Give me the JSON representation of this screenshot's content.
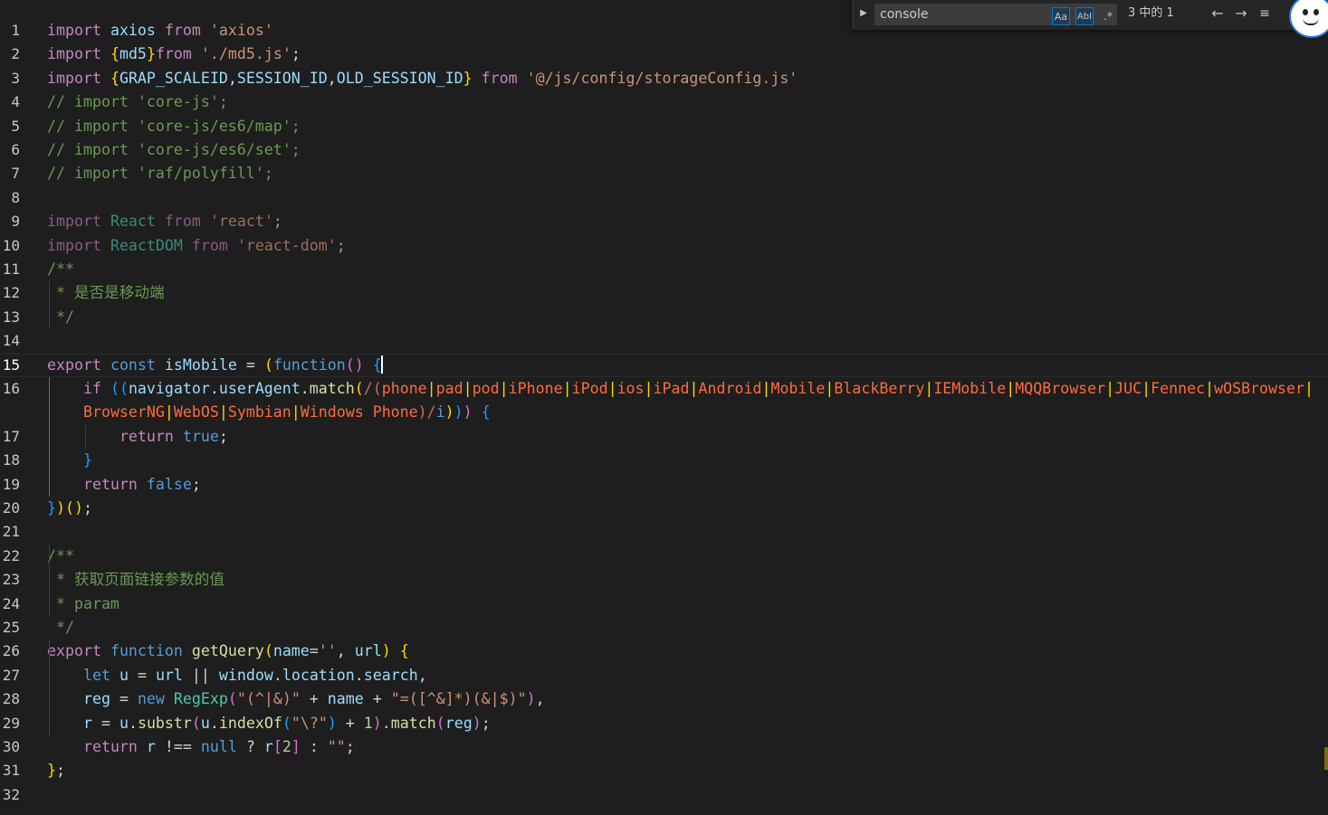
{
  "colors": {
    "background": "#1e1e1e",
    "keyword_control": "#c586c0",
    "keyword": "#569cd6",
    "string": "#ce9178",
    "regex": "#d16969",
    "function": "#dcdcaa",
    "variable": "#9cdcfe",
    "class": "#4ec9b0",
    "comment": "#6a9955",
    "number": "#b5cea8",
    "bracket_gold": "#ffd700",
    "bracket_purple": "#da70d6",
    "bracket_blue": "#179fff"
  },
  "find_widget": {
    "query": "console",
    "match_case_label": "Aa",
    "whole_word_label": "AbI",
    "regex_label": ".*",
    "result_count": "3 中的 1",
    "prev_icon": "arrow-up-icon",
    "next_icon": "arrow-down-icon",
    "selection_icon": "find-in-selection-icon",
    "close_icon": "close-icon"
  },
  "editor": {
    "active_line": 15,
    "lines": [
      {
        "n": "1",
        "tokens": [
          [
            "import",
            "#c586c0"
          ],
          [
            " "
          ],
          [
            "axios",
            "#9cdcfe"
          ],
          [
            " "
          ],
          [
            "from",
            "#c586c0"
          ],
          [
            " "
          ],
          [
            "'axios'",
            "#ce9178"
          ]
        ]
      },
      {
        "n": "2",
        "tokens": [
          [
            "import",
            "#c586c0"
          ],
          [
            " "
          ],
          [
            "{",
            "#ffd700"
          ],
          [
            "md5",
            "#9cdcfe"
          ],
          [
            "}",
            "#ffd700"
          ],
          [
            "from",
            "#c586c0"
          ],
          [
            " "
          ],
          [
            "'./md5.js'",
            "#ce9178"
          ],
          [
            ";"
          ]
        ]
      },
      {
        "n": "3",
        "tokens": [
          [
            "import",
            "#c586c0"
          ],
          [
            " "
          ],
          [
            "{",
            "#ffd700"
          ],
          [
            "GRAP_SCALEID",
            "#9cdcfe"
          ],
          [
            ","
          ],
          [
            "SESSION_ID",
            "#9cdcfe"
          ],
          [
            ","
          ],
          [
            "OLD_SESSION_ID",
            "#9cdcfe"
          ],
          [
            "}",
            "#ffd700"
          ],
          [
            " "
          ],
          [
            "from",
            "#c586c0"
          ],
          [
            " "
          ],
          [
            "'@/js/config/storageConfig.js'",
            "#ce9178"
          ]
        ]
      },
      {
        "n": "4",
        "tokens": [
          [
            "// import 'core-js';",
            "#6a9955"
          ]
        ]
      },
      {
        "n": "5",
        "tokens": [
          [
            "// import 'core-js/es6/map';",
            "#6a9955"
          ]
        ]
      },
      {
        "n": "6",
        "tokens": [
          [
            "// import 'core-js/es6/set';",
            "#6a9955"
          ]
        ]
      },
      {
        "n": "7",
        "tokens": [
          [
            "// import 'raf/polyfill';",
            "#6a9955"
          ]
        ]
      },
      {
        "n": "8",
        "tokens": []
      },
      {
        "n": "9",
        "tokens": [
          [
            "import",
            "#8a5a86"
          ],
          [
            " "
          ],
          [
            "React",
            "#3a8a7c"
          ],
          [
            " "
          ],
          [
            "from",
            "#8a5a86"
          ],
          [
            " "
          ],
          [
            "'react'",
            "#9a6e5c"
          ],
          [
            ";",
            "#9a9a9a"
          ]
        ]
      },
      {
        "n": "10",
        "tokens": [
          [
            "import",
            "#8a5a86"
          ],
          [
            " "
          ],
          [
            "ReactDOM",
            "#3a8a7c"
          ],
          [
            " "
          ],
          [
            "from",
            "#8a5a86"
          ],
          [
            " "
          ],
          [
            "'react-dom'",
            "#9a6e5c"
          ],
          [
            ";",
            "#9a9a9a"
          ]
        ]
      },
      {
        "n": "11",
        "tokens": [
          [
            "/**",
            "#6a9955"
          ]
        ]
      },
      {
        "n": "12",
        "tokens": [
          [
            " * 是否是移动端",
            "#6a9955"
          ]
        ]
      },
      {
        "n": "13",
        "tokens": [
          [
            " */",
            "#6a9955"
          ]
        ]
      },
      {
        "n": "14",
        "tokens": []
      },
      {
        "n": "15",
        "tokens": [
          [
            "export",
            "#c586c0"
          ],
          [
            " "
          ],
          [
            "const",
            "#569cd6"
          ],
          [
            " "
          ],
          [
            "isMobile",
            "#9cdcfe"
          ],
          [
            " = "
          ],
          [
            "(",
            "#ffd700"
          ],
          [
            "function",
            "#569cd6"
          ],
          [
            "()",
            "#da70d6"
          ],
          [
            " "
          ],
          [
            "{",
            "#179fff"
          ]
        ]
      },
      {
        "n": "16",
        "tokens": [
          [
            "    "
          ],
          [
            "if",
            "#c586c0"
          ],
          [
            " "
          ],
          [
            "((",
            "#179fff"
          ],
          [
            "navigator",
            "#9cdcfe"
          ],
          [
            "."
          ],
          [
            "userAgent",
            "#9cdcfe"
          ],
          [
            "."
          ],
          [
            "match",
            "#dcdcaa"
          ],
          [
            "(",
            "#ffd700"
          ],
          [
            "/(",
            "#d16969"
          ],
          [
            "phone",
            "#ff6b3d"
          ],
          [
            "|",
            "#ffd700"
          ],
          [
            "pad",
            "#ff6b3d"
          ],
          [
            "|",
            "#ffd700"
          ],
          [
            "pod",
            "#ff6b3d"
          ],
          [
            "|",
            "#ffd700"
          ],
          [
            "iPhone",
            "#ff6b3d"
          ],
          [
            "|",
            "#ffd700"
          ],
          [
            "iPod",
            "#ff6b3d"
          ],
          [
            "|",
            "#ffd700"
          ],
          [
            "ios",
            "#ff6b3d"
          ],
          [
            "|",
            "#ffd700"
          ],
          [
            "iPad",
            "#ff6b3d"
          ],
          [
            "|",
            "#ffd700"
          ],
          [
            "Android",
            "#ff6b3d"
          ],
          [
            "|",
            "#ffd700"
          ],
          [
            "Mobile",
            "#ff6b3d"
          ],
          [
            "|",
            "#ffd700"
          ],
          [
            "BlackBerry",
            "#ff6b3d"
          ],
          [
            "|",
            "#ffd700"
          ],
          [
            "IEMobile",
            "#ff6b3d"
          ],
          [
            "|",
            "#ffd700"
          ],
          [
            "MQQBrowser",
            "#ff6b3d"
          ],
          [
            "|",
            "#ffd700"
          ],
          [
            "JUC",
            "#ff6b3d"
          ],
          [
            "|",
            "#ffd700"
          ],
          [
            "Fennec",
            "#ff6b3d"
          ],
          [
            "|",
            "#ffd700"
          ],
          [
            "wOSBrowser",
            "#ff6b3d"
          ],
          [
            "|",
            "#ffd700"
          ]
        ]
      },
      {
        "n": "",
        "tokens": [
          [
            "    "
          ],
          [
            "BrowserNG",
            "#ff6b3d"
          ],
          [
            "|",
            "#ffd700"
          ],
          [
            "WebOS",
            "#ff6b3d"
          ],
          [
            "|",
            "#ffd700"
          ],
          [
            "Symbian",
            "#ff6b3d"
          ],
          [
            "|",
            "#ffd700"
          ],
          [
            "Windows Phone",
            "#ff6b3d"
          ],
          [
            ")/",
            "#d16969"
          ],
          [
            "i",
            "#569cd6"
          ],
          [
            ")",
            "#ffd700"
          ],
          [
            ")",
            "#179fff"
          ],
          [
            ")",
            "#da70d6"
          ],
          [
            " "
          ],
          [
            "{",
            "#179fff"
          ]
        ]
      },
      {
        "n": "17",
        "tokens": [
          [
            "        "
          ],
          [
            "return",
            "#c586c0"
          ],
          [
            " "
          ],
          [
            "true",
            "#569cd6"
          ],
          [
            ";"
          ]
        ]
      },
      {
        "n": "18",
        "tokens": [
          [
            "    "
          ],
          [
            "}",
            "#179fff"
          ]
        ]
      },
      {
        "n": "19",
        "tokens": [
          [
            "    "
          ],
          [
            "return",
            "#c586c0"
          ],
          [
            " "
          ],
          [
            "false",
            "#569cd6"
          ],
          [
            ";"
          ]
        ]
      },
      {
        "n": "20",
        "tokens": [
          [
            "}",
            "#179fff"
          ],
          [
            ")",
            "#ffd700"
          ],
          [
            "()",
            "#ffd700"
          ],
          [
            ";"
          ]
        ]
      },
      {
        "n": "21",
        "tokens": []
      },
      {
        "n": "22",
        "tokens": [
          [
            "/**",
            "#6a9955"
          ]
        ]
      },
      {
        "n": "23",
        "tokens": [
          [
            " * 获取页面链接参数的值",
            "#6a9955"
          ]
        ]
      },
      {
        "n": "24",
        "tokens": [
          [
            " * param",
            "#6a9955"
          ]
        ]
      },
      {
        "n": "25",
        "tokens": [
          [
            " */",
            "#6a9955"
          ]
        ]
      },
      {
        "n": "26",
        "tokens": [
          [
            "export",
            "#c586c0"
          ],
          [
            " "
          ],
          [
            "function",
            "#569cd6"
          ],
          [
            " "
          ],
          [
            "getQuery",
            "#dcdcaa"
          ],
          [
            "(",
            "#ffd700"
          ],
          [
            "name",
            "#9cdcfe"
          ],
          [
            "="
          ],
          [
            "''",
            "#ce9178"
          ],
          [
            ", "
          ],
          [
            "url",
            "#9cdcfe"
          ],
          [
            ")",
            "#ffd700"
          ],
          [
            " "
          ],
          [
            "{",
            "#ffd700"
          ]
        ]
      },
      {
        "n": "27",
        "tokens": [
          [
            "    "
          ],
          [
            "let",
            "#569cd6"
          ],
          [
            " "
          ],
          [
            "u",
            "#9cdcfe"
          ],
          [
            " = "
          ],
          [
            "url",
            "#9cdcfe"
          ],
          [
            " || "
          ],
          [
            "window",
            "#9cdcfe"
          ],
          [
            "."
          ],
          [
            "location",
            "#9cdcfe"
          ],
          [
            "."
          ],
          [
            "search",
            "#9cdcfe"
          ],
          [
            ","
          ]
        ]
      },
      {
        "n": "28",
        "tokens": [
          [
            "    "
          ],
          [
            "reg",
            "#9cdcfe"
          ],
          [
            " = "
          ],
          [
            "new",
            "#569cd6"
          ],
          [
            " "
          ],
          [
            "RegExp",
            "#4ec9b0"
          ],
          [
            "(",
            "#da70d6"
          ],
          [
            "\"(^|&)\"",
            "#ce9178"
          ],
          [
            " + "
          ],
          [
            "name",
            "#9cdcfe"
          ],
          [
            " + "
          ],
          [
            "\"=([^&]*)(&|$)\"",
            "#ce9178"
          ],
          [
            ")",
            "#da70d6"
          ],
          [
            ","
          ]
        ]
      },
      {
        "n": "29",
        "tokens": [
          [
            "    "
          ],
          [
            "r",
            "#9cdcfe"
          ],
          [
            " = "
          ],
          [
            "u",
            "#9cdcfe"
          ],
          [
            "."
          ],
          [
            "substr",
            "#dcdcaa"
          ],
          [
            "(",
            "#da70d6"
          ],
          [
            "u",
            "#9cdcfe"
          ],
          [
            "."
          ],
          [
            "indexOf",
            "#dcdcaa"
          ],
          [
            "(",
            "#179fff"
          ],
          [
            "\"\\?\"",
            "#ce9178"
          ],
          [
            ")",
            "#179fff"
          ],
          [
            " + "
          ],
          [
            "1",
            "#b5cea8"
          ],
          [
            ")",
            "#da70d6"
          ],
          [
            "."
          ],
          [
            "match",
            "#dcdcaa"
          ],
          [
            "(",
            "#da70d6"
          ],
          [
            "reg",
            "#9cdcfe"
          ],
          [
            ")",
            "#da70d6"
          ],
          [
            ";"
          ]
        ]
      },
      {
        "n": "30",
        "tokens": [
          [
            "    "
          ],
          [
            "return",
            "#c586c0"
          ],
          [
            " "
          ],
          [
            "r",
            "#9cdcfe"
          ],
          [
            " !== "
          ],
          [
            "null",
            "#569cd6"
          ],
          [
            " ? "
          ],
          [
            "r",
            "#9cdcfe"
          ],
          [
            "[",
            "#da70d6"
          ],
          [
            "2",
            "#b5cea8"
          ],
          [
            "]",
            "#da70d6"
          ],
          [
            " : "
          ],
          [
            "\"\"",
            "#ce9178"
          ],
          [
            ";"
          ]
        ]
      },
      {
        "n": "31",
        "tokens": [
          [
            "}",
            "#ffd700"
          ],
          [
            ";"
          ]
        ]
      },
      {
        "n": "32",
        "tokens": []
      }
    ]
  }
}
